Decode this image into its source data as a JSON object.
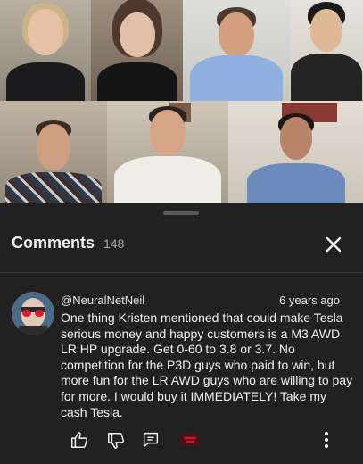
{
  "comments_panel": {
    "title": "Comments",
    "count": "148"
  },
  "comment": {
    "author": "@NeuralNetNeil",
    "time": "6 years ago",
    "text": "One thing Kristen mentioned that could make Tesla serious money and happy customers is a M3 AWD LR HP upgrade. Get 0-60 to 3.8 or 3.7. No competition for the P3D guys who paid to win, but more fun for the LR AWD guys who are willing to pay for more. I would buy it IMMEDIATELY! Take my cash Tesla."
  },
  "icons": {
    "close": "close-icon",
    "like": "thumbs-up-icon",
    "dislike": "thumbs-down-icon",
    "reply": "reply-icon",
    "heart": "creator-heart-icon",
    "more": "more-vert-icon"
  },
  "colors": {
    "panel_bg": "#212121",
    "text": "#f1f1f1",
    "secondary_text": "#aaaaaa"
  }
}
